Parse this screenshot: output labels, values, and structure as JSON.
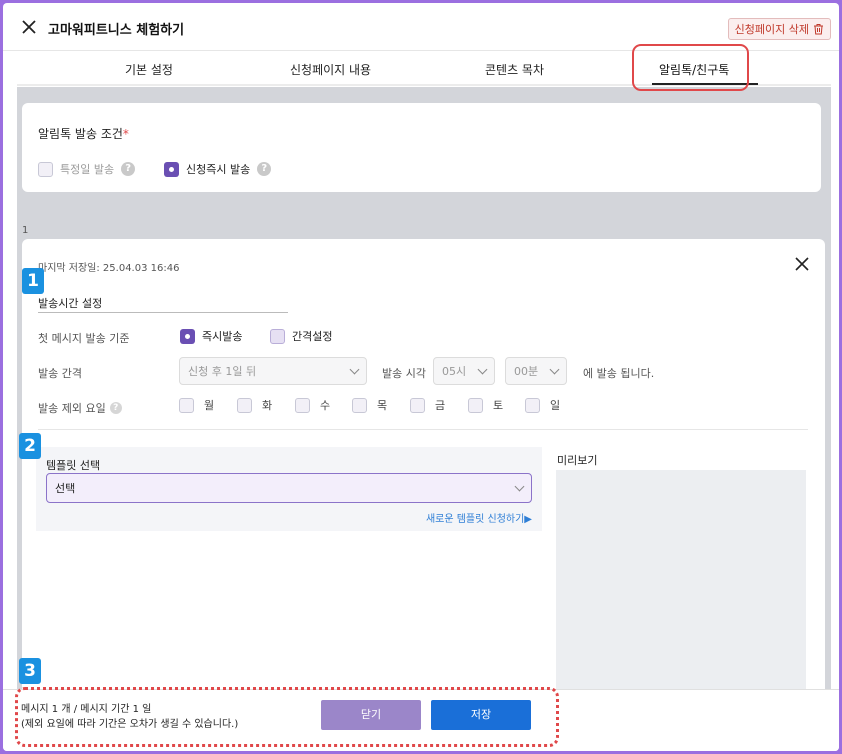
{
  "header": {
    "title": "고마워피트니스 체험하기",
    "delete_label": "신청페이지 삭제"
  },
  "tabs": [
    {
      "label": "기본 설정"
    },
    {
      "label": "신청페이지 내용"
    },
    {
      "label": "콘텐츠 목차"
    },
    {
      "label": "알림톡/친구톡"
    }
  ],
  "send_condition": {
    "title": "알림톡 발송 조건",
    "required_mark": "*",
    "options": [
      {
        "label": "특정일 발송",
        "checked": false
      },
      {
        "label": "신청즉시 발송",
        "checked": true
      }
    ]
  },
  "item_index": "1",
  "message": {
    "last_saved": "마지막 저장일: 25.04.03 16:46",
    "badges": [
      "1",
      "2",
      "3"
    ],
    "time_setting_title": "발송시간 설정",
    "first_msg_label": "첫 메시지 발송 기준",
    "first_msg_options": [
      {
        "label": "즉시발송",
        "selected": true
      },
      {
        "label": "간격설정",
        "selected": false
      }
    ],
    "interval_label": "발송 간격",
    "interval_value": "신청 후 1일 뒤",
    "send_time_label": "발송 시각",
    "hour_value": "05시",
    "minute_value": "00분",
    "send_suffix": "에 발송 됩니다.",
    "exclude_label": "발송 제외 요일",
    "days": [
      "월",
      "화",
      "수",
      "목",
      "금",
      "토",
      "일"
    ],
    "template_label": "템플릿 선택",
    "template_value": "선택",
    "template_link": "새로운 템플릿 신청하기▶",
    "preview_label": "미리보기"
  },
  "footer": {
    "note_line1": "메시지 1 개 / 메시지 기간 1 일",
    "note_line2": "(제외 요일에 따라 기간은 오차가 생길 수 있습니다.)",
    "cancel_label": "닫기",
    "save_label": "저장"
  },
  "colors": {
    "accent_purple": "#6a4fb3",
    "save_blue": "#1a6fd8",
    "highlight_red": "#e0484a",
    "badge_blue": "#1a91e0"
  }
}
